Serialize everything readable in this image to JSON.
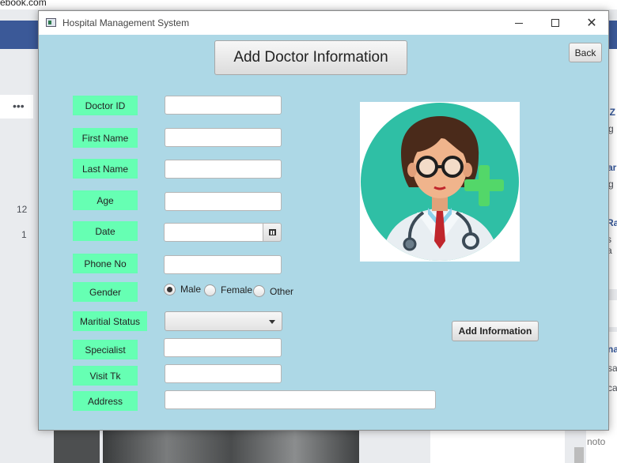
{
  "background": {
    "top_text": "ebook.com",
    "left_more": "•••",
    "left_nums": [
      "12",
      "1"
    ],
    "right_snips": [
      "g Z",
      "g",
      "ar",
      "g",
      "Ra",
      "s a",
      "na",
      "sa",
      "ca",
      "noto"
    ]
  },
  "window": {
    "title": "Hospital Management System",
    "controls": {
      "minimize": "",
      "maximize": "",
      "close": "✕"
    }
  },
  "header": {
    "title": "Add Doctor Information"
  },
  "back_button": "Back",
  "form": {
    "labels": {
      "doctor_id": "Doctor ID",
      "first_name": "First Name",
      "last_name": "Last Name",
      "age": "Age",
      "date": "Date",
      "phone": "Phone No",
      "gender": "Gender",
      "marital": "Maritial Status",
      "specialist": "Specialist",
      "visit": "Visit Tk",
      "address": "Address"
    },
    "values": {
      "doctor_id": "",
      "first_name": "",
      "last_name": "",
      "age": "",
      "date": "",
      "phone": "",
      "marital": "",
      "specialist": "",
      "visit": "",
      "address": ""
    },
    "gender_options": [
      {
        "label": "Male",
        "selected": true
      },
      {
        "label": "Female",
        "selected": false
      },
      {
        "label": "Other",
        "selected": false
      }
    ]
  },
  "add_button": "Add Information",
  "colors": {
    "window_bg": "#add8e6",
    "label_bg": "#66ffb3",
    "avatar_circle": "#2fbfa5",
    "cross": "#53d769"
  }
}
